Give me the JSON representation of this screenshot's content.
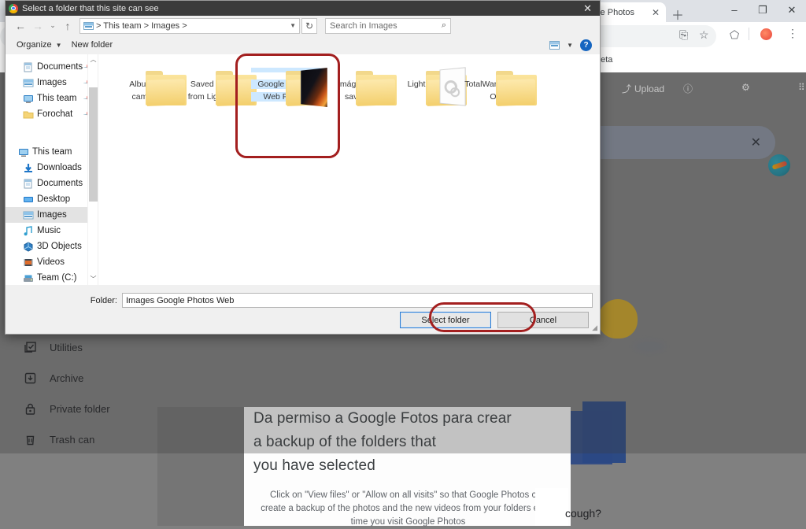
{
  "browser": {
    "tab_title": "gle Photos",
    "tab_close_icon": "close-icon",
    "new_tab_icon": "plus-icon",
    "window_minimize": "–",
    "window_maximize": "❐",
    "window_close": "✕",
    "toolbar_icons": [
      "cast-icon",
      "star-icon",
      "extensions-icon",
      "profile-icon",
      "menu-icon"
    ],
    "beta_label": "beta"
  },
  "photos_app": {
    "header": {
      "upload_label": "Upload",
      "help_icon": "help-icon",
      "settings_icon": "gear-icon",
      "apps_icon": "apps-grid-icon",
      "avatar": "avatar"
    },
    "search_close_icon": "close-icon",
    "nav_items": [
      {
        "label": "Utilities",
        "icon": "utilities-icon"
      },
      {
        "label": "Archive",
        "icon": "archive-icon"
      },
      {
        "label": "Private folder",
        "icon": "lock-icon"
      },
      {
        "label": "Trash can",
        "icon": "trash-icon"
      }
    ],
    "card": {
      "heading_line1": "Da permiso a Google Fotos para crear",
      "heading_line2": "a backup of the folders that",
      "heading_line3": "you have selected",
      "body": "Click on \"View files\" or \"Allow on all visits\" so that Google Photos can create a backup of the photos and the new videos from your folders every time you visit Google Photos"
    },
    "bottom_text": "cough?"
  },
  "dialog": {
    "title": "Select a folder that this site can see",
    "close_icon": "close-icon",
    "nav": {
      "back_icon": "arrow-left-icon",
      "forward_icon": "arrow-right-icon",
      "recent_icon": "chevron-down-icon",
      "up_icon": "arrow-up-icon",
      "address_value": "> This team > Images >",
      "address_caret": "chevron-down-icon",
      "refresh_icon": "refresh-icon",
      "search_placeholder": "Search in Images",
      "search_icon": "search-icon"
    },
    "toolbar": {
      "organize_label": "Organize",
      "organize_caret": "chevron-down-icon",
      "new_folder_label": "New folder",
      "view_icon": "view-layout-icon",
      "view_caret": "chevron-down-icon",
      "help_icon": "help-icon"
    },
    "tree": {
      "quick_access": [
        {
          "label": "Documents",
          "icon": "documents-icon",
          "pinned": true
        },
        {
          "label": "Images",
          "icon": "images-icon",
          "pinned": true
        },
        {
          "label": "This team",
          "icon": "computer-icon",
          "pinned": true
        },
        {
          "label": "Forochat",
          "icon": "folder-icon",
          "pinned": true
        }
      ],
      "this_pc": [
        {
          "label": "This team",
          "icon": "computer-icon",
          "selected": false
        },
        {
          "label": "Downloads",
          "icon": "downloads-icon",
          "selected": false
        },
        {
          "label": "Documents",
          "icon": "documents-icon",
          "selected": false
        },
        {
          "label": "Desktop",
          "icon": "desktop-icon",
          "selected": false
        },
        {
          "label": "Images",
          "icon": "images-icon",
          "selected": true
        },
        {
          "label": "Music",
          "icon": "music-icon",
          "selected": false
        },
        {
          "label": "3D Objects",
          "icon": "3d-objects-icon",
          "selected": false
        },
        {
          "label": "Videos",
          "icon": "videos-icon",
          "selected": false
        },
        {
          "label": "Team (C:)",
          "icon": "drive-icon",
          "selected": false
        }
      ]
    },
    "folders": [
      {
        "line1": "Album of",
        "line2": "camera",
        "type": "plain",
        "selected": false
      },
      {
        "line1": "Saved photos",
        "line2": "from Lightroom",
        "type": "plain",
        "selected": false
      },
      {
        "line1": "Google Images",
        "line2": "Web Photos",
        "type": "photo",
        "selected": true
      },
      {
        "line1": "Imágenes",
        "line2": "saved",
        "type": "plain",
        "selected": false
      },
      {
        "line1": "Lightroom",
        "line2": "",
        "type": "docs",
        "selected": false
      },
      {
        "line1": "TotalWarSagaTR",
        "line2": "OY",
        "type": "plain",
        "selected": false
      }
    ],
    "footer": {
      "folder_label": "Folder:",
      "folder_value": "Images Google Photos Web",
      "select_button": "Select folder",
      "cancel_button": "Cancel"
    }
  },
  "annotations": {
    "highlight_color": "#a31f1f",
    "selection_color": "#cde8ff"
  }
}
